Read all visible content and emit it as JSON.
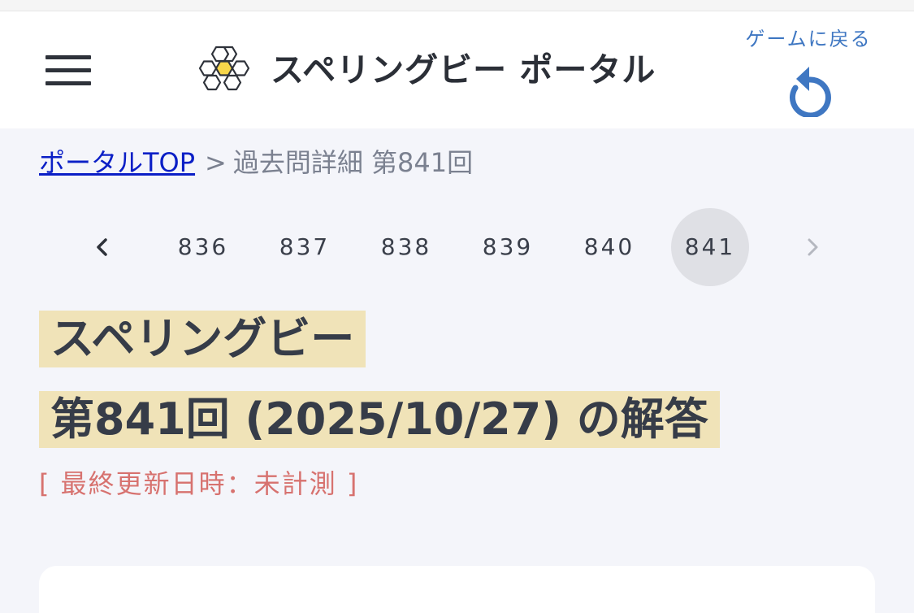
{
  "header": {
    "site_title": "スペリングビー ポータル",
    "back_label": "ゲームに戻る",
    "icons": {
      "menu": "hamburger-menu-icon",
      "logo": "honeycomb-logo-icon",
      "back": "undo-arrow-icon"
    }
  },
  "breadcrumb": {
    "home_label": "ポータルTOP",
    "separator": ">",
    "current": "過去問詳細 第841回"
  },
  "pager": {
    "prev_icon": "chevron-left-icon",
    "next_icon": "chevron-right-icon",
    "pages": [
      "836",
      "837",
      "838",
      "839",
      "840",
      "841"
    ],
    "active": "841"
  },
  "title": {
    "line1": "スペリングビー",
    "line2": "第841回 (2025/10/27) の解答"
  },
  "updated_text": "[ 最終更新日時：未計測 ]",
  "colors": {
    "highlight": "#f0e3b8",
    "link": "#0b1fc6",
    "accent_blue": "#3f77c2",
    "updated_red": "#d7726f",
    "honeycomb_center": "#f7d64a"
  }
}
